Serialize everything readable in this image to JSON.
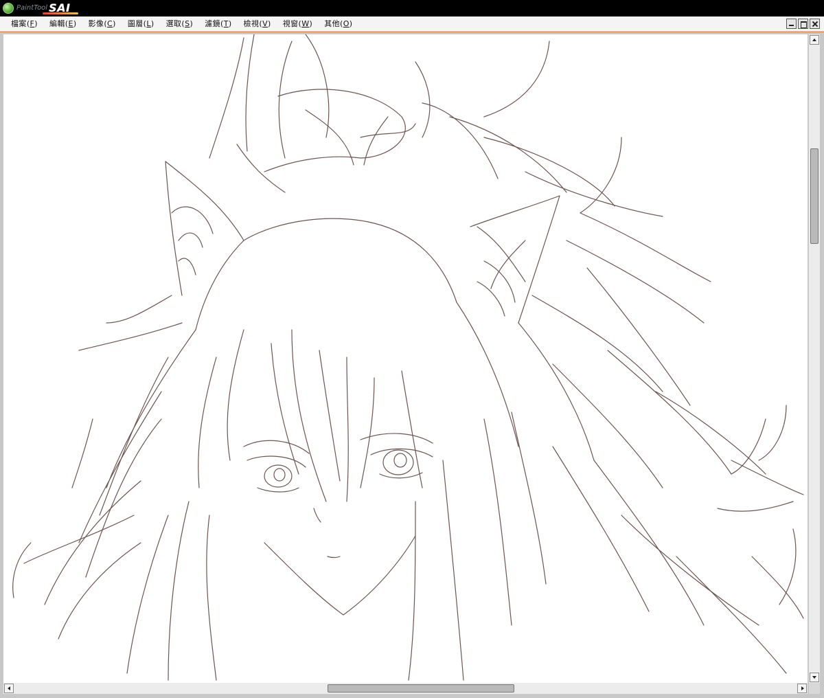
{
  "app": {
    "logo_text": "PaintTool",
    "logo_brand": "SAI"
  },
  "menu": [
    {
      "label": "檔案",
      "key": "F"
    },
    {
      "label": "編輯",
      "key": "E"
    },
    {
      "label": "影像",
      "key": "C"
    },
    {
      "label": "圖層",
      "key": "L"
    },
    {
      "label": "選取",
      "key": "S"
    },
    {
      "label": "濾鏡",
      "key": "T"
    },
    {
      "label": "檢視",
      "key": "V"
    },
    {
      "label": "視窗",
      "key": "W"
    },
    {
      "label": "其他",
      "key": "O"
    }
  ],
  "window_buttons": [
    "minimize-icon",
    "maximize-icon",
    "close-icon"
  ],
  "canvas": {
    "line_color": "#6b5550",
    "background": "#ffffff"
  },
  "colors": {
    "titlebar": "#000000",
    "menubar": "#f4f4f4",
    "accent_border": "#e08040"
  }
}
